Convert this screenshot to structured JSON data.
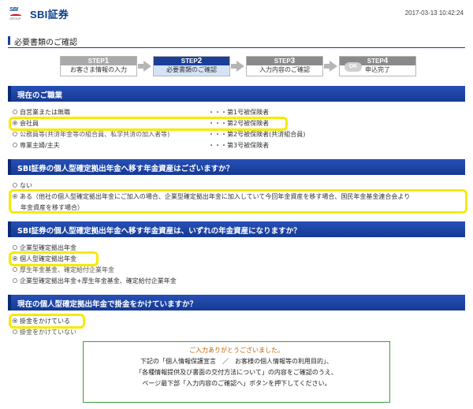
{
  "header": {
    "logo_small": "SBI",
    "logo_group": "GROUP",
    "logo_text": "SBI証券",
    "timestamp": "2017-03-13 10:42:24"
  },
  "page_title": "必要書類のご確認",
  "steps": [
    {
      "head": "STEP",
      "num": "1",
      "label": "お客さま情報の入力"
    },
    {
      "head": "STEP",
      "num": "2",
      "label": "必要書類のご確認"
    },
    {
      "head": "STEP",
      "num": "3",
      "label": "入力内容のご確認"
    },
    {
      "head": "STEP",
      "num": "4",
      "label": "申込完了",
      "badge": "OK"
    }
  ],
  "sections": {
    "occupation": {
      "title": "現在のご職業",
      "options": [
        {
          "label": "自営業または無職",
          "note": "・・・第1号被保険者",
          "checked": false
        },
        {
          "label": "会社員",
          "note": "・・・第2号被保険者",
          "checked": true
        },
        {
          "label": "公務員等(共済年金等の組合員、私学共済の加入者等)",
          "note": "・・・第2号被保険者(共済組合員)",
          "checked": false
        },
        {
          "label": "専業主婦/主夫",
          "note": "・・・第3号被保険者",
          "checked": false
        }
      ]
    },
    "transfer_assets": {
      "title": "SBI証券の個人型確定拠出年金へ移す年金資産はございますか？",
      "options": [
        {
          "label": "ない",
          "checked": false
        },
        {
          "label": "ある（他社の個人型確定拠出年金にご加入の場合、企業型確定拠出年金に加入していて今回年金資産を移す場合、国民年金基金連合会より",
          "label2": "年金資産を移す場合）",
          "checked": true
        }
      ]
    },
    "asset_type": {
      "title": "SBI証券の個人型確定拠出年金へ移す年金資産は、いずれの年金資産になりますか？",
      "options": [
        {
          "label": "企業型確定拠出年金",
          "checked": false
        },
        {
          "label": "個人型確定拠出年金",
          "checked": true
        },
        {
          "label": "厚生年金基金、確定給付企業年金",
          "checked": false
        },
        {
          "label": "企業型確定拠出年金+厚生年金基金、確定給付企業年金",
          "checked": false
        }
      ]
    },
    "contribution": {
      "title": "現在の個人型確定拠出年金で掛金をかけていますか？",
      "options": [
        {
          "label": "掛金をかけている",
          "checked": true
        },
        {
          "label": "掛金をかけていない",
          "checked": false
        }
      ]
    }
  },
  "thanks_box": {
    "lines": [
      "ご入力ありがとうございました。",
      "下記の「個人情報保護宣言　／　お客様の個人情報等の利用目的」、",
      "「各種情報提供及び書面の交付方法について」の内容をご確認のうえ、",
      "ページ最下部「入力内容のご確認へ」ボタンを押下してください。"
    ]
  },
  "colors": {
    "brand_blue": "#1a3f99",
    "highlight": "#f6ea00",
    "thanks_border": "#3a9a3a"
  }
}
